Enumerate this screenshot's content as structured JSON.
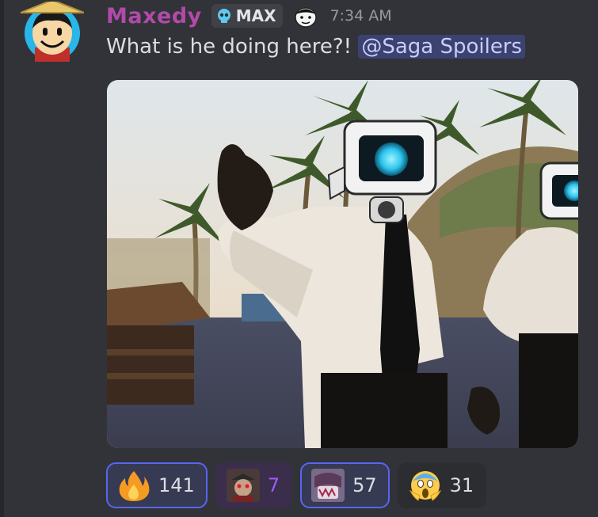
{
  "message": {
    "username": "Maxedy",
    "tag_label": "MAX",
    "timestamp": "7:34 AM",
    "text": "What is he doing here?!",
    "mention": "@Saga Spoilers"
  },
  "reactions": [
    {
      "emoji": "fire-emoji",
      "count": "141",
      "active": true
    },
    {
      "emoji": "custom-avatar-emoji",
      "count": "7",
      "active": false
    },
    {
      "emoji": "custom-creature-emoji",
      "count": "57",
      "active": true
    },
    {
      "emoji": "screaming-face-emoji",
      "count": "31",
      "active": false
    }
  ],
  "colors": {
    "background": "#313338",
    "username": "#b14aa9",
    "mention_bg": "#3c4270",
    "active_border": "#5865f2"
  }
}
